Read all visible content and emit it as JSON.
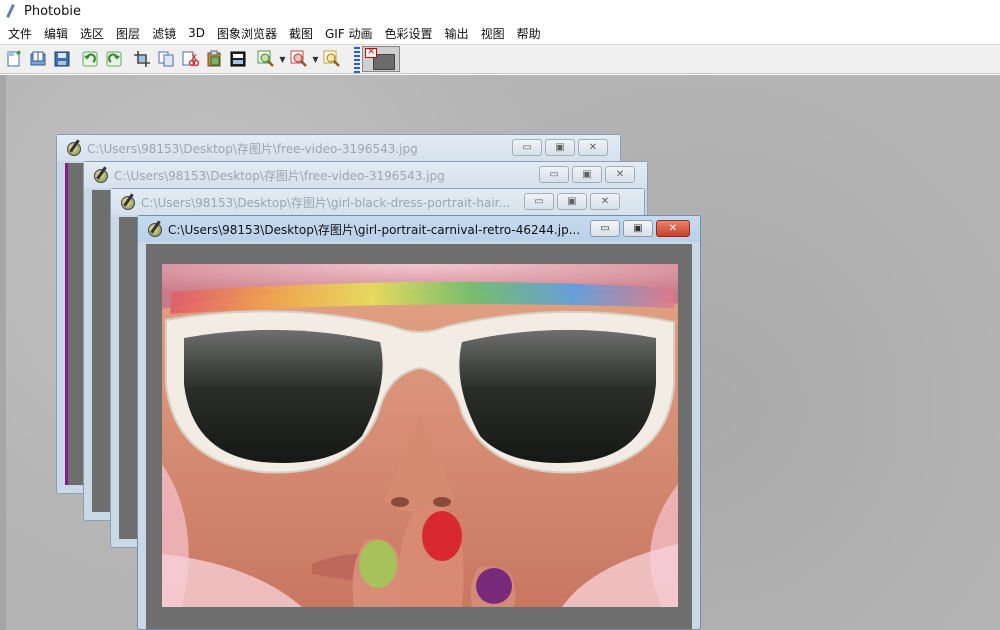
{
  "app": {
    "title": "Photobie"
  },
  "menu": [
    "文件",
    "编辑",
    "选区",
    "图层",
    "滤镜",
    "3D",
    "图象浏览器",
    "截图",
    "GIF 动画",
    "色彩设置",
    "输出",
    "视图",
    "帮助"
  ],
  "toolbar": {
    "buttons": [
      "new-icon",
      "open-icon",
      "save-icon",
      "undo-icon",
      "redo-icon",
      "crop-icon",
      "copy-icon",
      "cut-icon",
      "paste-icon",
      "paste-new-icon",
      "zoom-in-icon",
      "zoom-out-icon",
      "zoom-fit-icon"
    ]
  },
  "windows": [
    {
      "title": "C:\\Users\\98153\\Desktop\\存图片\\free-video-3196543.jpg",
      "active": false
    },
    {
      "title": "C:\\Users\\98153\\Desktop\\存图片\\free-video-3196543.jpg",
      "active": false
    },
    {
      "title": "C:\\Users\\98153\\Desktop\\存图片\\girl-black-dress-portrait-hair...",
      "active": false
    },
    {
      "title": "C:\\Users\\98153\\Desktop\\存图片\\girl-portrait-carnival-retro-46244.jp...",
      "active": true
    }
  ],
  "window_controls": {
    "minimize": "▭",
    "maximize": "▣",
    "close": "✕"
  },
  "colors": {
    "accent": "#2b5fd9",
    "close": "#c9402a",
    "workspace": "#b4b4b4",
    "canvas": "#6e6e6e"
  }
}
